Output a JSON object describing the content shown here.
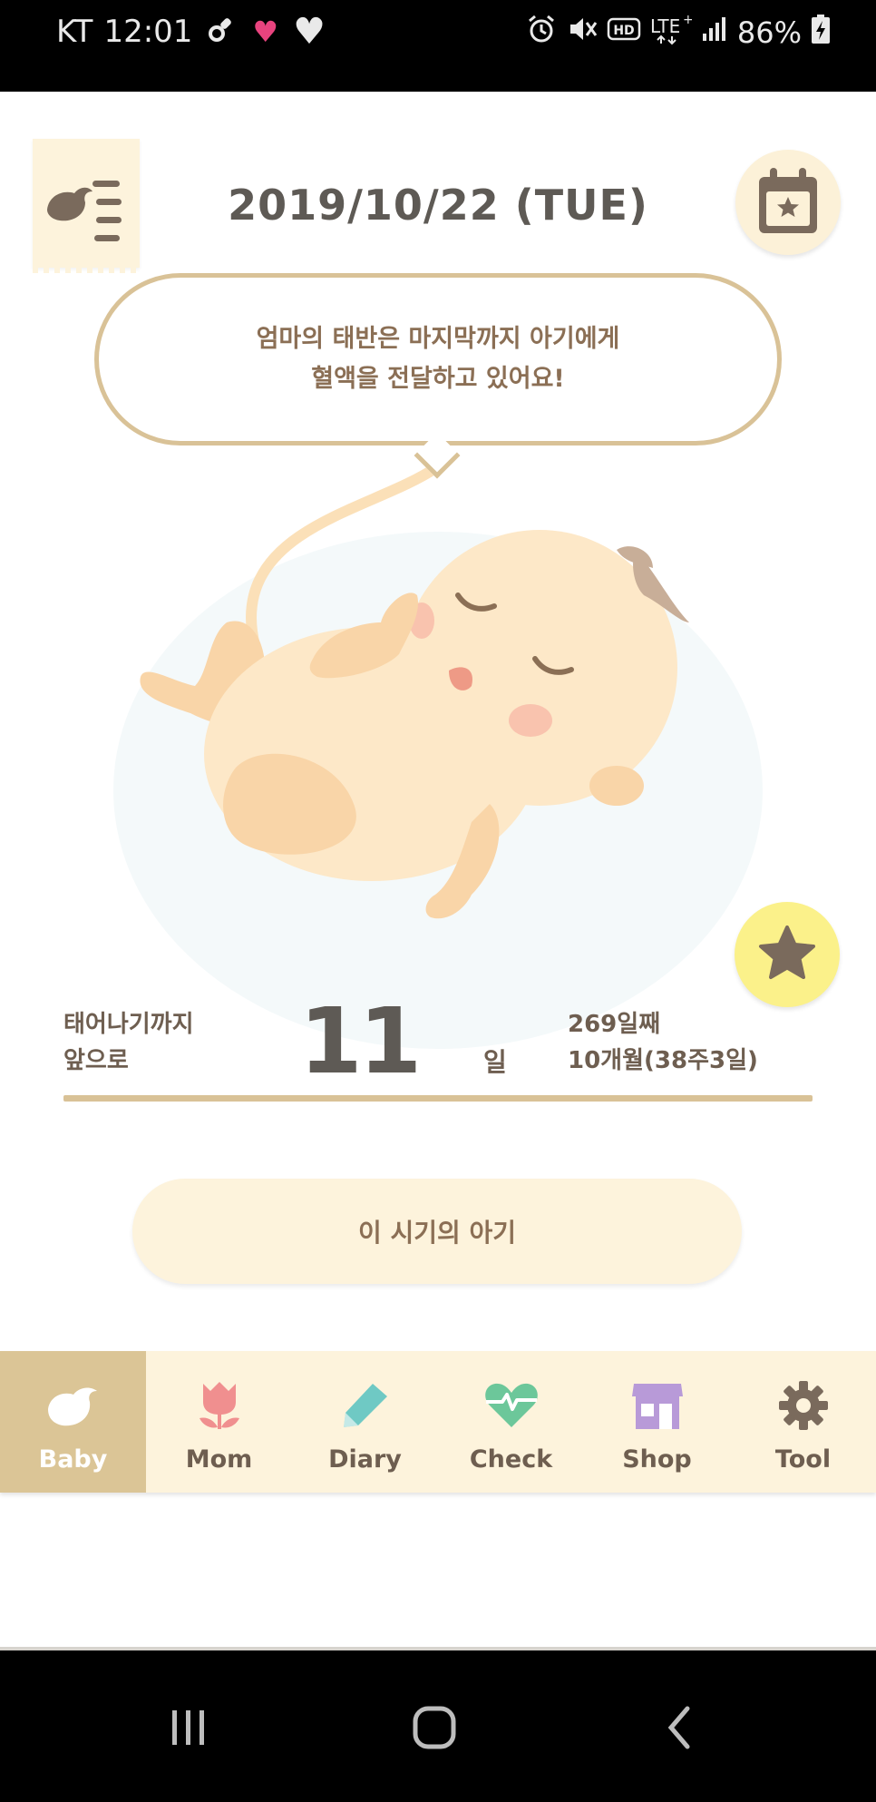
{
  "status_bar": {
    "carrier": "KT",
    "time": "12:01",
    "battery": "86%",
    "icons_left": [
      "pacifier-icon",
      "heart-pink-icon",
      "heart-white-icon"
    ],
    "icons_right": [
      "alarm-icon",
      "mute-icon",
      "hd-icon",
      "lte-icon",
      "signal-icon",
      "battery-charging-icon"
    ]
  },
  "header": {
    "date": "2019/10/22 (TUE)"
  },
  "bubble": {
    "line1": "엄마의 태반은 마지막까지 아기에게",
    "line2": "혈액을 전달하고 있어요!"
  },
  "countdown": {
    "label_line1": "태어나기까지",
    "label_line2": "앞으로",
    "days_left": "11",
    "unit": "일",
    "day_count": "269일째",
    "month_week": "10개월(38주3일)"
  },
  "baby_period_button": "이 시기의 아기",
  "bottom_nav": {
    "items": [
      {
        "label": "Baby",
        "icon": "bird-icon",
        "color": "#ffffff",
        "active": true
      },
      {
        "label": "Mom",
        "icon": "tulip-icon",
        "color": "#f08f8f",
        "active": false
      },
      {
        "label": "Diary",
        "icon": "pencil-icon",
        "color": "#6fc9c4",
        "active": false
      },
      {
        "label": "Check",
        "icon": "heartbeat-icon",
        "color": "#6cc79a",
        "active": false
      },
      {
        "label": "Shop",
        "icon": "store-icon",
        "color": "#b89ad8",
        "active": false
      },
      {
        "label": "Tool",
        "icon": "gear-icon",
        "color": "#7a6a5c",
        "active": false
      }
    ]
  },
  "colors": {
    "accent_beige": "#dbc596",
    "cream": "#fdf3dc",
    "text_brown": "#8b6f55",
    "star_yellow": "#fbf18a"
  }
}
